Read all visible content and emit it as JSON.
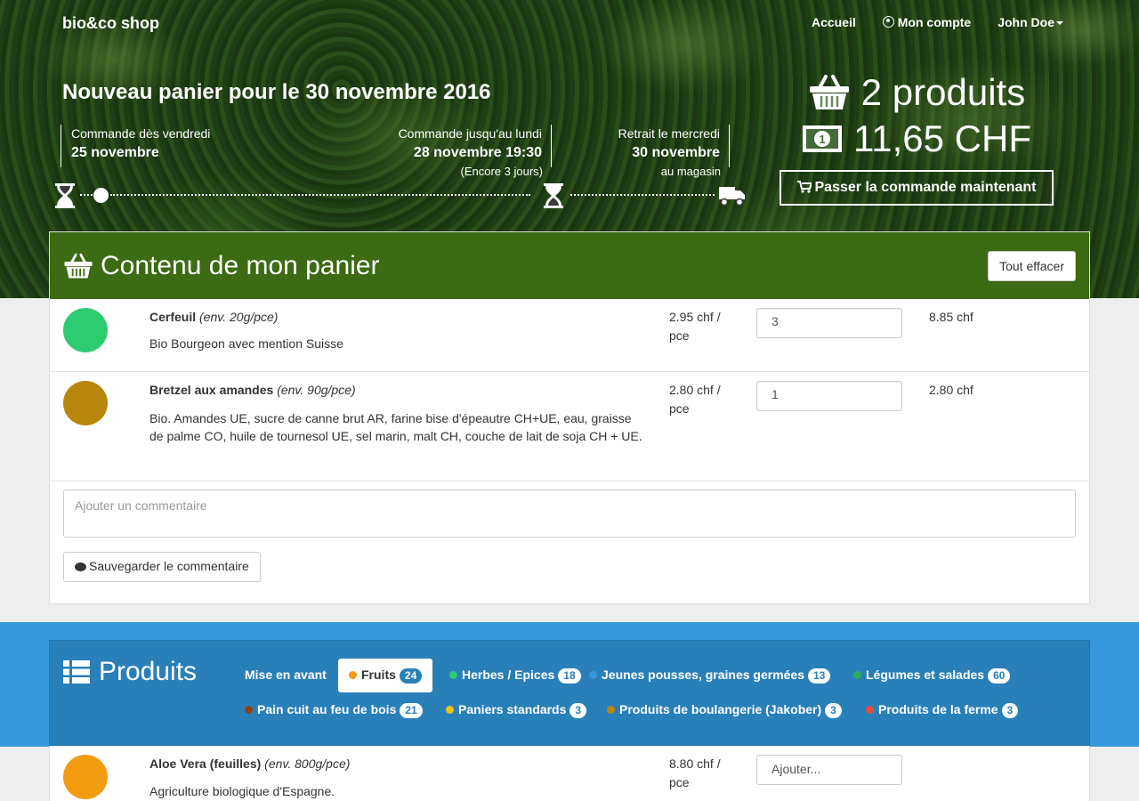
{
  "nav": {
    "brand": "bio&co shop",
    "home": "Accueil",
    "account": "Mon compte",
    "user": "John Doe"
  },
  "hero": {
    "title": "Nouveau panier pour le 30 novembre 2016",
    "step1_label": "Commande dès vendredi",
    "step1_value": "25 novembre",
    "step2_label": "Commande jusqu'au lundi",
    "step2_value": "28 novembre 19:30",
    "step2_sub": "(Encore 3 jours)",
    "step3_label": "Retrait le mercredi",
    "step3_value": "30 novembre",
    "step3_sub": "au magasin"
  },
  "summary": {
    "products": "2 produits",
    "total": "11,65 CHF",
    "order_button": "Passer la commande maintenant"
  },
  "cart": {
    "title": "Contenu de mon panier",
    "clear_button": "Tout effacer",
    "items": [
      {
        "name": "Cerfeuil",
        "weight": "(env. 20g/pce)",
        "description": "Bio Bourgeon avec mention Suisse",
        "price": "2.95 chf / pce",
        "quantity": "3",
        "total": "8.85 chf",
        "color": "#2ecc71"
      },
      {
        "name": "Bretzel aux amandes",
        "weight": "(env. 90g/pce)",
        "description": "Bio. Amandes UE, sucre de canne brut AR, farine bise d'épeautre CH+UE, eau, graisse de palme CO, huile de tournesol UE, sel marin, malt CH, couche de lait de soja CH + UE.",
        "price": "2.80 chf / pce",
        "quantity": "1",
        "total": "2.80 chf",
        "color": "#b8860b"
      }
    ],
    "comment_placeholder": "Ajouter un commentaire",
    "save_comment": "Sauvegarder le commentaire"
  },
  "products": {
    "title": "Produits",
    "featured": "Mise en avant",
    "categories": [
      {
        "label": "Fruits",
        "count": "24",
        "color": "#f39c12",
        "active": true
      },
      {
        "label": "Herbes / Epices",
        "count": "18",
        "color": "#2ecc71"
      },
      {
        "label": "Jeunes pousses, graines germées",
        "count": "13",
        "color": "#3498db"
      },
      {
        "label": "Légumes et salades",
        "count": "60",
        "color": "#27ae60"
      },
      {
        "label": "Pain cuit au feu de bois",
        "count": "21",
        "color": "#8b4513"
      },
      {
        "label": "Paniers standards",
        "count": "3",
        "color": "#f1c40f"
      },
      {
        "label": "Produits de boulangerie (Jakober)",
        "count": "3",
        "color": "#b8860b"
      },
      {
        "label": "Produits de la ferme",
        "count": "3",
        "color": "#e74c3c"
      }
    ],
    "list": [
      {
        "name": "Aloe Vera (feuilles)",
        "weight": "(env. 800g/pce)",
        "description": "Agriculture biologique d'Espagne.",
        "price": "8.80 chf / pce",
        "add_placeholder": "Ajouter...",
        "color": "#f39c12"
      }
    ]
  }
}
